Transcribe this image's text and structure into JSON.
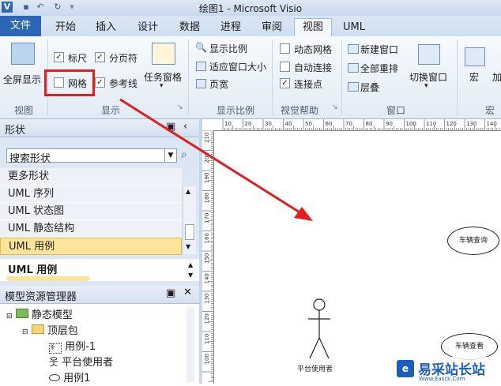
{
  "window": {
    "title": "绘图1 - Microsoft Visio",
    "qa_icons": [
      "visio-logo-icon",
      "save-icon",
      "undo-icon",
      "redo-icon",
      "customize-icon"
    ]
  },
  "tabs": [
    "文件",
    "开始",
    "插入",
    "设计",
    "数据",
    "进程",
    "审阅",
    "视图",
    "UML"
  ],
  "active_tab": "视图",
  "ribbon": {
    "view_group": {
      "fullscreen": "全屏显示",
      "label": "视图"
    },
    "show_group": {
      "ruler": "标尺",
      "ruler_checked": true,
      "pagebreaks": "分页符",
      "pagebreaks_checked": true,
      "grid": "网格",
      "grid_checked": false,
      "guides": "参考线",
      "guides_checked": true,
      "taskpanes": "任务窗格",
      "label": "显示"
    },
    "zoom_group": {
      "zoom": "显示比例",
      "fit": "适应窗口大小",
      "pagewidth": "页宽",
      "label": "显示比例"
    },
    "visual_group": {
      "dynamic_grid": "动态网格",
      "dynamic_grid_checked": false,
      "autoconnect": "自动连接",
      "autoconnect_checked": false,
      "connection_points": "连接点",
      "connection_points_checked": true,
      "label": "视觉帮助"
    },
    "window_group": {
      "new": "新建窗口",
      "arrange": "全部重排",
      "cascade": "层叠",
      "switch": "切换窗口",
      "label": "窗口"
    },
    "macro_group": {
      "macro": "宏",
      "addin": "加",
      "label": "宏"
    }
  },
  "shapes_pane": {
    "title": "形状",
    "search_placeholder": "搜索形状",
    "items": [
      "更多形状",
      "UML 序列",
      "UML 状态图",
      "UML 静态结构",
      "UML 用例"
    ],
    "selected": "UML 用例",
    "stencil_title": "UML 用例"
  },
  "model_pane": {
    "title": "模型资源管理器",
    "tree": [
      "静态模型",
      "顶层包",
      "用例-1",
      "平台使用者",
      "用例1"
    ]
  },
  "ruler": {
    "h_ticks": [
      "10",
      "20",
      "30",
      "40",
      "50",
      "60",
      "70",
      "80",
      "90",
      "100",
      "110",
      "120",
      "130",
      "140"
    ],
    "v_ticks": [
      "210",
      "200",
      "190",
      "180",
      "170",
      "160",
      "150",
      "140",
      "130",
      "120",
      "110",
      "100"
    ]
  },
  "canvas": {
    "usecase1": "车辆查询",
    "usecase2": "车辆查看",
    "actor": "平台使用者"
  },
  "watermark": {
    "text": "易采站长站",
    "sub": "Www.Easck.Com"
  }
}
